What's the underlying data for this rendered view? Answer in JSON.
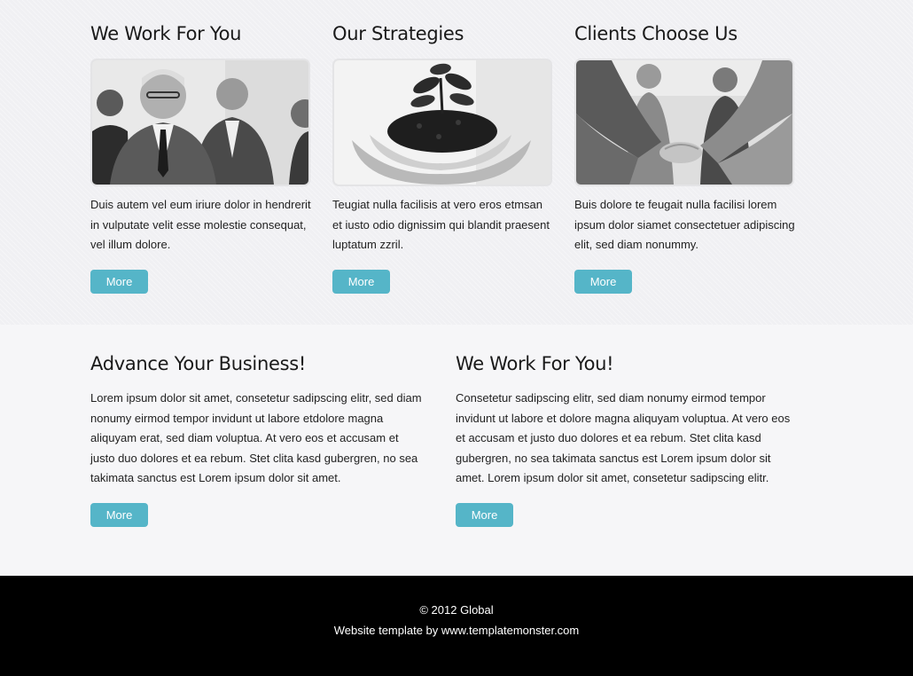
{
  "features": [
    {
      "title": "We Work For You",
      "text": "Duis autem vel eum iriure dolor in hendrerit in vulputate velit esse molestie consequat, vel illum dolore.",
      "button": "More",
      "image_icon": "business-people-photo"
    },
    {
      "title": "Our Strategies",
      "text": "Teugiat nulla facilisis at vero eros etmsan et iusto odio dignissim qui blandit praesent luptatum zzril.",
      "button": "More",
      "image_icon": "plant-in-hands-photo"
    },
    {
      "title": "Clients Choose Us",
      "text": "Buis dolore te feugait nulla facilisi lorem ipsum dolor siamet consectetuer adipiscing elit, sed diam nonummy.",
      "button": "More",
      "image_icon": "handshake-photo"
    }
  ],
  "sections": [
    {
      "title": "Advance Your Business!",
      "text": "Lorem ipsum dolor sit amet, consetetur sadipscing elitr, sed diam nonumy eirmod tempor invidunt ut labore etdolore magna aliquyam erat, sed diam voluptua. At vero eos et accusam et justo duo dolores et ea rebum. Stet clita kasd gubergren, no sea takimata sanctus est Lorem ipsum dolor sit amet.",
      "button": "More"
    },
    {
      "title": "We Work For You!",
      "text": "Consetetur sadipscing elitr, sed diam nonumy eirmod tempor invidunt ut labore et dolore magna aliquyam voluptua. At vero eos et accusam et justo duo dolores et ea rebum. Stet clita kasd gubergren, no sea takimata sanctus est Lorem ipsum dolor sit amet. Lorem ipsum dolor sit amet, consetetur sadipscing elitr.",
      "button": "More"
    }
  ],
  "footer": {
    "copyright": "© 2012 Global",
    "credit": "Website template by www.templatemonster.com"
  },
  "colors": {
    "accent": "#55b5c8",
    "footer_bg": "#000000"
  }
}
